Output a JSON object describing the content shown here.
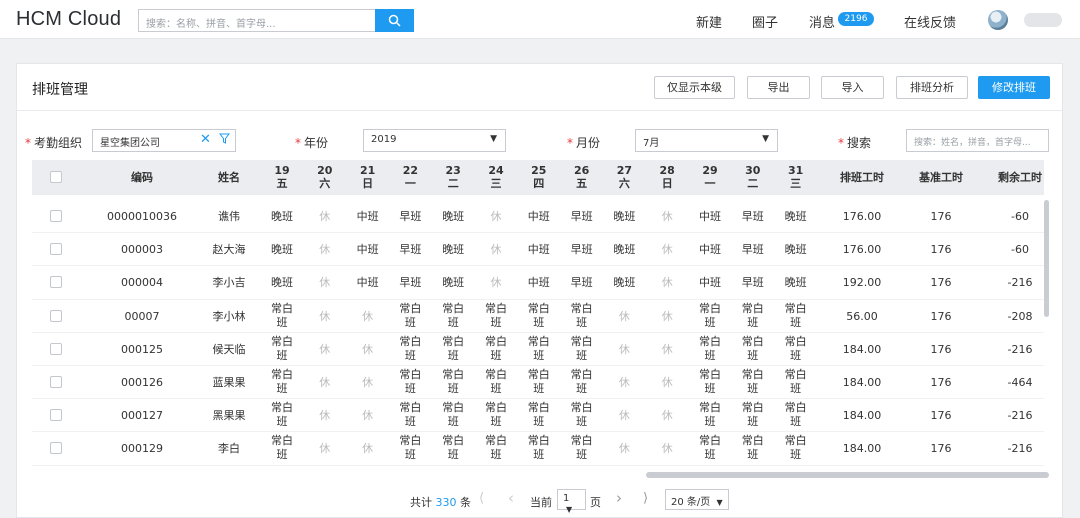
{
  "app": {
    "title": "HCM Cloud"
  },
  "search": {
    "placeholder": "搜索：名称、拼音、首字母..."
  },
  "nav": {
    "new": "新建",
    "circle": "圈子",
    "messages": "消息",
    "message_count": "2196",
    "feedback": "在线反馈"
  },
  "page": {
    "title": "排班管理"
  },
  "toolbar": {
    "only_this_level": "仅显示本级",
    "export": "导出",
    "import": "导入",
    "analysis": "排班分析",
    "modify": "修改排班"
  },
  "filters": {
    "org_label": "考勤组织",
    "org_value": "星空集团公司",
    "year_label": "年份",
    "year_value": "2019",
    "month_label": "月份",
    "month_value": "7月",
    "search_label": "搜索",
    "search_placeholder": "搜索：姓名，拼音，首字母..."
  },
  "table": {
    "headers": {
      "code": "编码",
      "name": "姓名",
      "scheduled_hours": "排班工时",
      "base_hours": "基准工时",
      "remaining_hours": "剩余工时"
    },
    "days": [
      {
        "date": "19",
        "weekday": "五"
      },
      {
        "date": "20",
        "weekday": "六"
      },
      {
        "date": "21",
        "weekday": "日"
      },
      {
        "date": "22",
        "weekday": "一"
      },
      {
        "date": "23",
        "weekday": "二"
      },
      {
        "date": "24",
        "weekday": "三"
      },
      {
        "date": "25",
        "weekday": "四"
      },
      {
        "date": "26",
        "weekday": "五"
      },
      {
        "date": "27",
        "weekday": "六"
      },
      {
        "date": "28",
        "weekday": "日"
      },
      {
        "date": "29",
        "weekday": "一"
      },
      {
        "date": "30",
        "weekday": "二"
      },
      {
        "date": "31",
        "weekday": "三"
      }
    ],
    "rows": [
      {
        "code": "0000010036",
        "name": "谯伟",
        "shifts": [
          "晚班",
          "休",
          "中班",
          "早班",
          "晚班",
          "休",
          "中班",
          "早班",
          "晚班",
          "休",
          "中班",
          "早班",
          "晚班"
        ],
        "scheduled": "176.00",
        "base": "176",
        "remaining": "-60"
      },
      {
        "code": "000003",
        "name": "赵大海",
        "shifts": [
          "晚班",
          "休",
          "中班",
          "早班",
          "晚班",
          "休",
          "中班",
          "早班",
          "晚班",
          "休",
          "中班",
          "早班",
          "晚班"
        ],
        "scheduled": "176.00",
        "base": "176",
        "remaining": "-60"
      },
      {
        "code": "000004",
        "name": "李小吉",
        "shifts": [
          "晚班",
          "休",
          "中班",
          "早班",
          "晚班",
          "休",
          "中班",
          "早班",
          "晚班",
          "休",
          "中班",
          "早班",
          "晚班"
        ],
        "scheduled": "192.00",
        "base": "176",
        "remaining": "-216"
      },
      {
        "code": "00007",
        "name": "李小林",
        "shifts": [
          "常白班",
          "休",
          "休",
          "常白班",
          "常白班",
          "常白班",
          "常白班",
          "常白班",
          "休",
          "休",
          "常白班",
          "常白班",
          "常白班"
        ],
        "scheduled": "56.00",
        "base": "176",
        "remaining": "-208"
      },
      {
        "code": "000125",
        "name": "候天临",
        "shifts": [
          "常白班",
          "休",
          "休",
          "常白班",
          "常白班",
          "常白班",
          "常白班",
          "常白班",
          "休",
          "休",
          "常白班",
          "常白班",
          "常白班"
        ],
        "scheduled": "184.00",
        "base": "176",
        "remaining": "-216"
      },
      {
        "code": "000126",
        "name": "蓝果果",
        "shifts": [
          "常白班",
          "休",
          "休",
          "常白班",
          "常白班",
          "常白班",
          "常白班",
          "常白班",
          "休",
          "休",
          "常白班",
          "常白班",
          "常白班"
        ],
        "scheduled": "184.00",
        "base": "176",
        "remaining": "-464"
      },
      {
        "code": "000127",
        "name": "黑果果",
        "shifts": [
          "常白班",
          "休",
          "休",
          "常白班",
          "常白班",
          "常白班",
          "常白班",
          "常白班",
          "休",
          "休",
          "常白班",
          "常白班",
          "常白班"
        ],
        "scheduled": "184.00",
        "base": "176",
        "remaining": "-216"
      },
      {
        "code": "000129",
        "name": "李白",
        "shifts": [
          "常白班",
          "休",
          "休",
          "常白班",
          "常白班",
          "常白班",
          "常白班",
          "常白班",
          "休",
          "休",
          "常白班",
          "常白班",
          "常白班"
        ],
        "scheduled": "184.00",
        "base": "176",
        "remaining": "-216"
      }
    ]
  },
  "pagination": {
    "total_prefix": "共计",
    "total": "330",
    "total_suffix": "条",
    "first": "⟨",
    "prev": "‹",
    "current_label": "当前",
    "current_page": "1",
    "page_suffix": "页",
    "next": "›",
    "last": "⟩",
    "page_size": "20 条/页"
  },
  "colors": {
    "accent": "#1e9bf0",
    "required": "#e4393c",
    "rest_text": "#bbbbbb"
  },
  "icons": {
    "search": "search-icon",
    "clear": "close-icon",
    "filter": "filter-icon",
    "dropdown": "caret-down-icon",
    "avatar": "avatar"
  }
}
